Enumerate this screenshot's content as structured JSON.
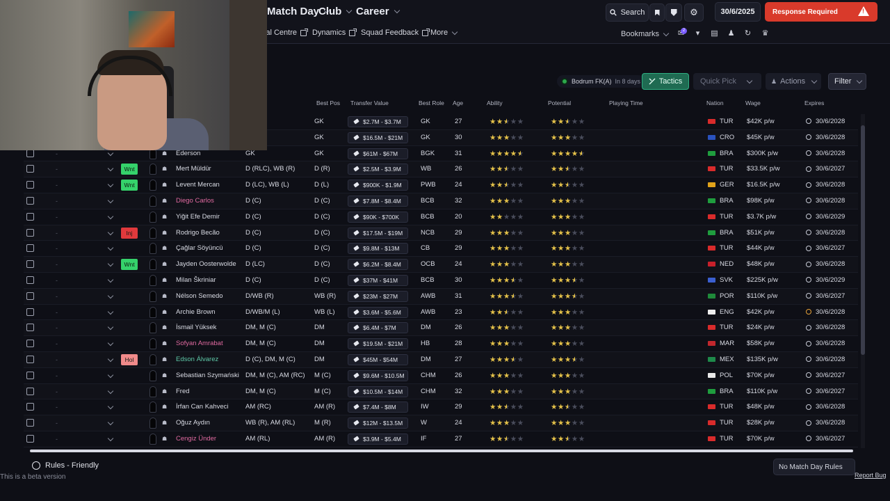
{
  "nav": {
    "main": [
      {
        "label": "Match Day"
      },
      {
        "label": "Club"
      },
      {
        "label": "Career"
      }
    ],
    "sub": [
      {
        "label": "Medical Centre"
      },
      {
        "label": "Dynamics"
      },
      {
        "label": "Squad Feedback"
      }
    ],
    "sub_more": "More",
    "search": "Search",
    "date": "30/6/2025",
    "alert": "Response Required",
    "bookmarks": "Bookmarks",
    "notification_count": "2"
  },
  "toolbar": {
    "club_status": "Bodrum FK(A)",
    "club_status_detail": "In 8 days",
    "tactics": "Tactics",
    "quick_pick": "Quick Pick",
    "actions": "Actions",
    "filter": "Filter"
  },
  "columns": {
    "best_pos": "Best Pos",
    "transfer_value": "Transfer Value",
    "best_role": "Best Role",
    "age": "Age",
    "ability": "Ability",
    "potential": "Potential",
    "playing_time": "Playing Time",
    "nation": "Nation",
    "wage": "Wage",
    "expires": "Expires"
  },
  "rows": [
    {
      "tag": "",
      "tag_color": "",
      "name": "",
      "pos": "",
      "best_pos": "GK",
      "value": "$2.7M - $3.7M",
      "role": "GK",
      "age": "27",
      "ability": 2.5,
      "potential": 2.5,
      "nation": "TUR",
      "flag": "#d92b2b",
      "wage": "$42K p/w",
      "expires": "30/6/2028",
      "expiry_alert": false,
      "name_color": "#d9dbe4"
    },
    {
      "tag": "",
      "tag_color": "",
      "name": "",
      "pos": "",
      "best_pos": "GK",
      "value": "$16.5M - $21M",
      "role": "GK",
      "age": "30",
      "ability": 3,
      "potential": 3,
      "nation": "CRO",
      "flag": "#2a52be",
      "wage": "$45K p/w",
      "expires": "30/6/2028",
      "expiry_alert": false,
      "name_color": "#d9dbe4"
    },
    {
      "tag": "",
      "tag_color": "",
      "name": "Ederson",
      "pos": "GK",
      "best_pos": "GK",
      "value": "$61M - $67M",
      "role": "BGK",
      "age": "31",
      "ability": 4.5,
      "potential": 4.5,
      "nation": "BRA",
      "flag": "#1f9d3e",
      "wage": "$300K p/w",
      "expires": "30/6/2028",
      "expiry_alert": false,
      "name_color": "#d9dbe4"
    },
    {
      "tag": "Wnt",
      "tag_color": "#35d26b",
      "name": "Mert Müldür",
      "pos": "D (RLC), WB (R)",
      "best_pos": "D (R)",
      "value": "$2.5M - $3.9M",
      "role": "WB",
      "age": "26",
      "ability": 2.5,
      "potential": 2.5,
      "nation": "TUR",
      "flag": "#d92b2b",
      "wage": "$33.5K p/w",
      "expires": "30/6/2027",
      "expiry_alert": false,
      "name_color": "#d9dbe4"
    },
    {
      "tag": "Wnt",
      "tag_color": "#35d26b",
      "name": "Levent Mercan",
      "pos": "D (LC), WB (L)",
      "best_pos": "D (L)",
      "value": "$900K - $1.9M",
      "role": "PWB",
      "age": "24",
      "ability": 2.5,
      "potential": 2.5,
      "nation": "GER",
      "flag": "#e0a21a",
      "wage": "$16.5K p/w",
      "expires": "30/6/2028",
      "expiry_alert": false,
      "name_color": "#d9dbe4"
    },
    {
      "tag": "",
      "tag_color": "",
      "name": "Diego Carlos",
      "pos": "D (C)",
      "best_pos": "D (C)",
      "value": "$7.8M - $8.4M",
      "role": "BCB",
      "age": "32",
      "ability": 3,
      "potential": 3,
      "nation": "BRA",
      "flag": "#1f9d3e",
      "wage": "$98K p/w",
      "expires": "30/6/2028",
      "expiry_alert": false,
      "name_color": "#e06aa0"
    },
    {
      "tag": "",
      "tag_color": "",
      "name": "Yiğit Efe Demir",
      "pos": "D (C)",
      "best_pos": "D (C)",
      "value": "$90K - $700K",
      "role": "BCB",
      "age": "20",
      "ability": 2,
      "potential": 3,
      "nation": "TUR",
      "flag": "#d92b2b",
      "wage": "$3.7K p/w",
      "expires": "30/6/2029",
      "expiry_alert": false,
      "name_color": "#d9dbe4"
    },
    {
      "tag": "Inj",
      "tag_color": "#e0393c",
      "name": "Rodrigo Becão",
      "pos": "D (C)",
      "best_pos": "D (C)",
      "value": "$17.5M - $19M",
      "role": "NCB",
      "age": "29",
      "ability": 3,
      "potential": 3,
      "nation": "BRA",
      "flag": "#1f9d3e",
      "wage": "$51K p/w",
      "expires": "30/6/2028",
      "expiry_alert": false,
      "name_color": "#d9dbe4"
    },
    {
      "tag": "",
      "tag_color": "",
      "name": "Çağlar Söyüncü",
      "pos": "D (C)",
      "best_pos": "D (C)",
      "value": "$9.8M - $13M",
      "role": "CB",
      "age": "29",
      "ability": 3,
      "potential": 3,
      "nation": "TUR",
      "flag": "#d92b2b",
      "wage": "$44K p/w",
      "expires": "30/6/2027",
      "expiry_alert": false,
      "name_color": "#d9dbe4"
    },
    {
      "tag": "Wnt",
      "tag_color": "#35d26b",
      "name": "Jayden Oosterwolde",
      "pos": "D (LC)",
      "best_pos": "D (C)",
      "value": "$6.2M - $8.4M",
      "role": "OCB",
      "age": "24",
      "ability": 3,
      "potential": 3,
      "nation": "NED",
      "flag": "#c8202b",
      "wage": "$48K p/w",
      "expires": "30/6/2028",
      "expiry_alert": false,
      "name_color": "#d9dbe4"
    },
    {
      "tag": "",
      "tag_color": "",
      "name": "Milan Škriniar",
      "pos": "D (C)",
      "best_pos": "D (C)",
      "value": "$37M - $41M",
      "role": "BCB",
      "age": "30",
      "ability": 3.5,
      "potential": 3.5,
      "nation": "SVK",
      "flag": "#3b5fd0",
      "wage": "$225K p/w",
      "expires": "30/6/2029",
      "expiry_alert": false,
      "name_color": "#d9dbe4"
    },
    {
      "tag": "",
      "tag_color": "",
      "name": "Nélson Semedo",
      "pos": "D/WB (R)",
      "best_pos": "WB (R)",
      "value": "$23M - $27M",
      "role": "AWB",
      "age": "31",
      "ability": 3.5,
      "potential": 3.5,
      "nation": "POR",
      "flag": "#1f8a3a",
      "wage": "$110K p/w",
      "expires": "30/6/2027",
      "expiry_alert": false,
      "name_color": "#d9dbe4"
    },
    {
      "tag": "",
      "tag_color": "",
      "name": "Archie Brown",
      "pos": "D/WB/M (L)",
      "best_pos": "WB (L)",
      "value": "$3.6M - $5.6M",
      "role": "AWB",
      "age": "23",
      "ability": 2.5,
      "potential": 3,
      "nation": "ENG",
      "flag": "#eeeeee",
      "wage": "$42K p/w",
      "expires": "30/6/2028",
      "expiry_alert": true,
      "name_color": "#d9dbe4"
    },
    {
      "tag": "",
      "tag_color": "",
      "name": "İsmail Yüksek",
      "pos": "DM, M (C)",
      "best_pos": "DM",
      "value": "$6.4M - $7M",
      "role": "DM",
      "age": "26",
      "ability": 3,
      "potential": 3,
      "nation": "TUR",
      "flag": "#d92b2b",
      "wage": "$24K p/w",
      "expires": "30/6/2028",
      "expiry_alert": false,
      "name_color": "#d9dbe4"
    },
    {
      "tag": "",
      "tag_color": "",
      "name": "Sofyan Amrabat",
      "pos": "DM, M (C)",
      "best_pos": "DM",
      "value": "$19.5M - $21M",
      "role": "HB",
      "age": "28",
      "ability": 3,
      "potential": 3,
      "nation": "MAR",
      "flag": "#c1272d",
      "wage": "$58K p/w",
      "expires": "30/6/2028",
      "expiry_alert": false,
      "name_color": "#e06aa0"
    },
    {
      "tag": "Hol",
      "tag_color": "#f08a8a",
      "name": "Edson Álvarez",
      "pos": "D (C), DM, M (C)",
      "best_pos": "DM",
      "value": "$45M - $54M",
      "role": "DM",
      "age": "27",
      "ability": 3.5,
      "potential": 3.5,
      "nation": "MEX",
      "flag": "#1e8a4a",
      "wage": "$135K p/w",
      "expires": "30/6/2028",
      "expiry_alert": false,
      "name_color": "#5fc9a8"
    },
    {
      "tag": "",
      "tag_color": "",
      "name": "Sebastian Szymański",
      "pos": "DM, M (C), AM (RC)",
      "best_pos": "M (C)",
      "value": "$9.6M - $10.5M",
      "role": "CHM",
      "age": "26",
      "ability": 3,
      "potential": 3,
      "nation": "POL",
      "flag": "#e8e8e8",
      "wage": "$70K p/w",
      "expires": "30/6/2027",
      "expiry_alert": false,
      "name_color": "#d9dbe4"
    },
    {
      "tag": "",
      "tag_color": "",
      "name": "Fred",
      "pos": "DM, M (C)",
      "best_pos": "M (C)",
      "value": "$10.5M - $14M",
      "role": "CHM",
      "age": "32",
      "ability": 3,
      "potential": 3,
      "nation": "BRA",
      "flag": "#1f9d3e",
      "wage": "$110K p/w",
      "expires": "30/6/2027",
      "expiry_alert": false,
      "name_color": "#d9dbe4"
    },
    {
      "tag": "",
      "tag_color": "",
      "name": "İrfan Can Kahveci",
      "pos": "AM (RC)",
      "best_pos": "AM (R)",
      "value": "$7.4M - $8M",
      "role": "IW",
      "age": "29",
      "ability": 2.5,
      "potential": 2.5,
      "nation": "TUR",
      "flag": "#d92b2b",
      "wage": "$48K p/w",
      "expires": "30/6/2028",
      "expiry_alert": false,
      "name_color": "#d9dbe4"
    },
    {
      "tag": "",
      "tag_color": "",
      "name": "Oğuz Aydın",
      "pos": "WB (R), AM (RL)",
      "best_pos": "M (R)",
      "value": "$12M - $13.5M",
      "role": "W",
      "age": "24",
      "ability": 3,
      "potential": 3,
      "nation": "TUR",
      "flag": "#d92b2b",
      "wage": "$28K p/w",
      "expires": "30/6/2028",
      "expiry_alert": false,
      "name_color": "#d9dbe4"
    },
    {
      "tag": "",
      "tag_color": "",
      "name": "Cengiz Ünder",
      "pos": "AM (RL)",
      "best_pos": "AM (R)",
      "value": "$3.9M - $5.4M",
      "role": "IF",
      "age": "27",
      "ability": 2.5,
      "potential": 2.5,
      "nation": "TUR",
      "flag": "#d92b2b",
      "wage": "$70K p/w",
      "expires": "30/6/2027",
      "expiry_alert": false,
      "name_color": "#e06aa0"
    }
  ],
  "footer": {
    "rules": "Rules - Friendly",
    "beta": "This is a beta version",
    "no_match_day_rules": "No Match Day Rules",
    "report_bug": "Report Bug"
  }
}
